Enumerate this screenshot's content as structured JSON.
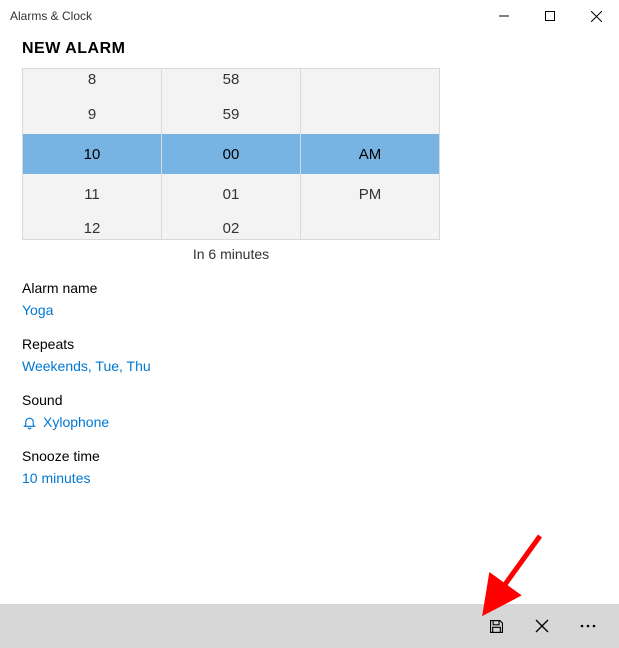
{
  "titlebar": {
    "title": "Alarms & Clock"
  },
  "page": {
    "heading": "NEW ALARM",
    "hint": "In 6 minutes"
  },
  "picker": {
    "hours": [
      "8",
      "9",
      "10",
      "11",
      "12"
    ],
    "minutes": [
      "58",
      "59",
      "00",
      "01",
      "02"
    ],
    "periods": [
      "",
      "",
      "AM",
      "PM",
      ""
    ]
  },
  "fields": {
    "name": {
      "label": "Alarm name",
      "value": "Yoga"
    },
    "repeats": {
      "label": "Repeats",
      "value": "Weekends, Tue, Thu"
    },
    "sound": {
      "label": "Sound",
      "value": "Xylophone"
    },
    "snooze": {
      "label": "Snooze time",
      "value": "10 minutes"
    }
  }
}
